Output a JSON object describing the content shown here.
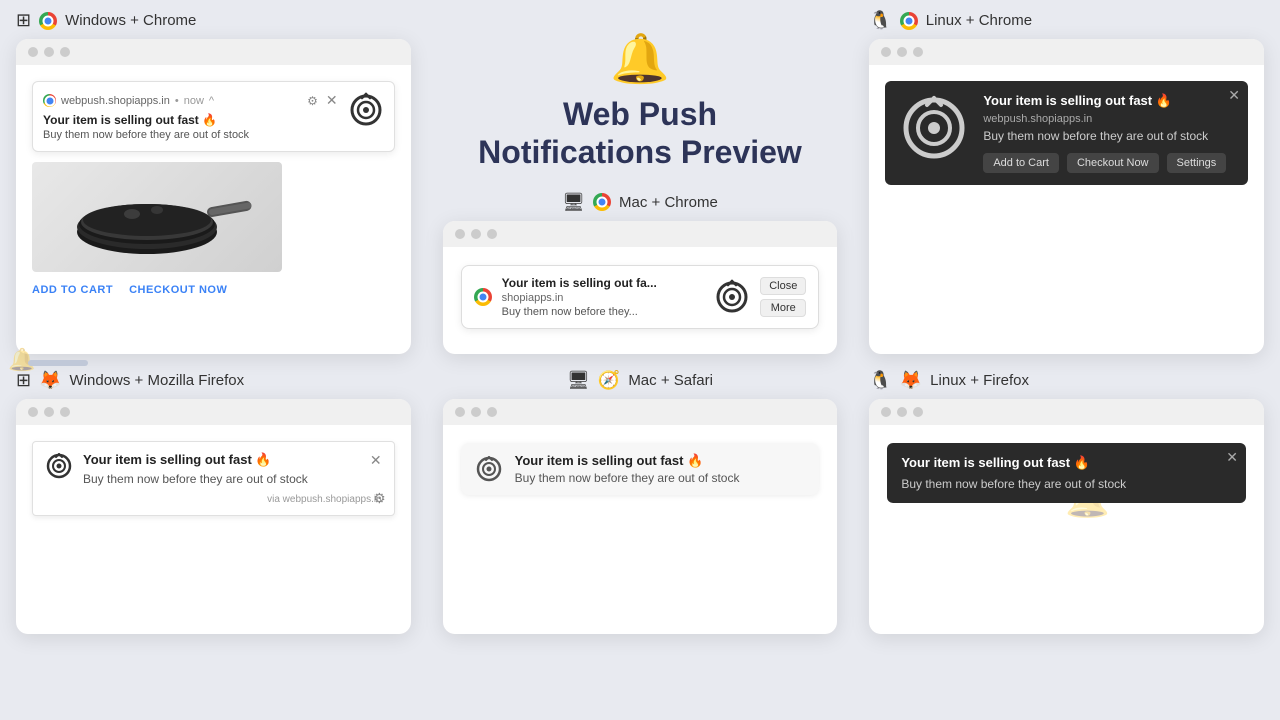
{
  "header": {
    "title_line1": "Web Push",
    "title_line2": "Notifications Preview",
    "bell_icon": "🔔"
  },
  "notification": {
    "title": "Your item is selling out fast 🔥",
    "body": "Buy them now before they are out of stock",
    "title_short": "Your item is selling out fa...",
    "body_short": "Buy them now before they...",
    "domain": "webpush.shopiapps.in",
    "domain_short": "shopiapps.in",
    "timestamp": "now",
    "caret": "^"
  },
  "platforms": {
    "win_chrome": {
      "os": "Windows",
      "browser": "Chrome",
      "label": "Windows + Chrome"
    },
    "mac_chrome": {
      "os": "Mac",
      "browser": "Chrome",
      "label": "Mac + Chrome"
    },
    "linux_chrome": {
      "os": "Linux",
      "browser": "Chrome",
      "label": "Linux + Chrome"
    },
    "win_firefox": {
      "os": "Windows",
      "browser": "Mozilla Firefox",
      "label": "Windows + Mozilla Firefox"
    },
    "mac_safari": {
      "os": "Mac",
      "browser": "Safari",
      "label": "Mac + Safari"
    },
    "linux_firefox": {
      "os": "Linux",
      "browser": "Firefox",
      "label": "Linux + Firefox"
    }
  },
  "buttons": {
    "add_to_cart": "ADD TO CART",
    "checkout_now": "CHECKOUT NOW",
    "add_to_cart_dark": "Add to Cart",
    "checkout_now_dark": "Checkout Now",
    "settings": "Settings",
    "close": "Close",
    "more": "More"
  },
  "via": "via webpush.shopiapps.in"
}
